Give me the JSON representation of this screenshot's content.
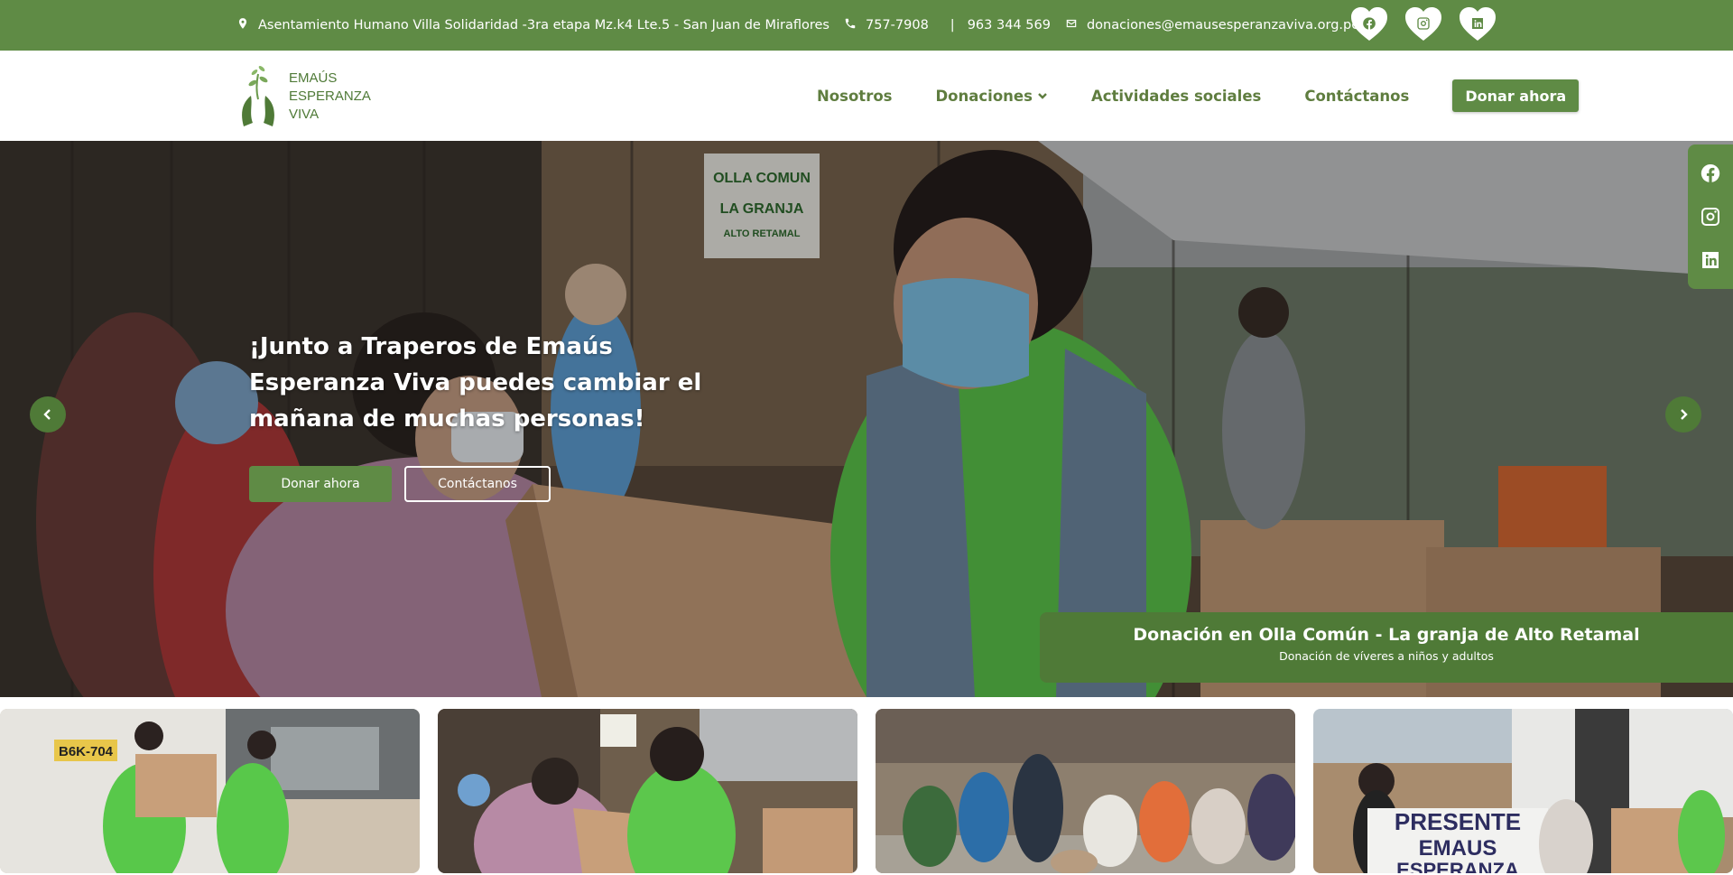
{
  "topbar": {
    "address": "Asentamiento Humano Villa Solidaridad -3ra etapa Mz.k4 Lte.5 - San Juan de Miraflores",
    "phone1": "757-7908",
    "separator": "|",
    "phone2": "963 344 569",
    "email": "donaciones@emausesperanzaviva.org.pe",
    "social": [
      "facebook-icon",
      "instagram-icon",
      "linkedin-icon"
    ]
  },
  "logo": {
    "line1": "EMAÚS",
    "line2": "ESPERANZA",
    "line3": "VIVA"
  },
  "nav": {
    "items": [
      {
        "label": "Nosotros"
      },
      {
        "label": "Donaciones"
      },
      {
        "label": "Actividades sociales"
      },
      {
        "label": "Contáctanos"
      }
    ],
    "cta": "Donar ahora"
  },
  "hero": {
    "title": "¡Junto a Traperos de Emaús Esperanza Viva puedes cambiar el mañana de muchas personas!",
    "primary_button": "Donar ahora",
    "secondary_button": "Contáctanos",
    "caption_title": "Donación en Olla Común - La granja de Alto Retamal",
    "caption_subtitle": "Donación de víveres a niños y adultos",
    "sign_text": [
      "OLLA COMUN",
      "LA GRANJA",
      "ALTO RETAMAL"
    ]
  },
  "thumbnails": {
    "truck_plate": "B6K-704",
    "banner_text": [
      "PRESENTE",
      "EMAUS",
      "ESPERANZA"
    ]
  },
  "colors": {
    "brand_green": "#5f8b45",
    "dark_green": "#4f7a37",
    "nav_text": "#5f7d3f"
  }
}
